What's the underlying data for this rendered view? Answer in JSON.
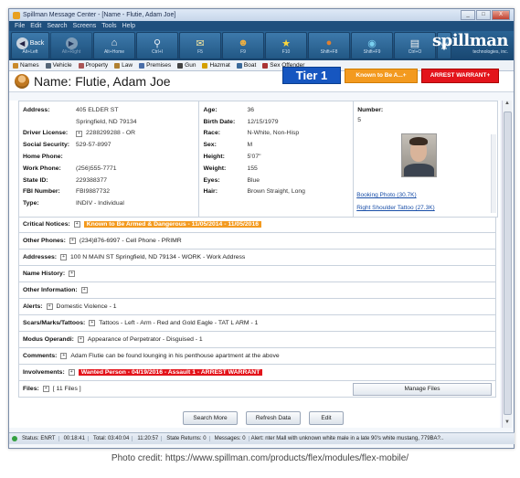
{
  "window": {
    "title": "Spillman Message Center - [Name - Flutie, Adam Joe]",
    "controls": [
      "_",
      "□",
      "X"
    ]
  },
  "menu": [
    "File",
    "Edit",
    "Search",
    "Screens",
    "Tools",
    "Help"
  ],
  "toolbar": {
    "back_label": "Back",
    "items": [
      {
        "caption": "Alt+Left",
        "icon": "back-icon"
      },
      {
        "caption": "Alt+Right",
        "icon": "forward-icon"
      },
      {
        "caption": "Alt+Home",
        "icon": "home-icon"
      },
      {
        "caption": "Ctrl+I",
        "icon": "search-icon"
      },
      {
        "caption": "F5",
        "icon": "mail-icon"
      },
      {
        "caption": "F9",
        "icon": "officer-icon"
      },
      {
        "caption": "F10",
        "icon": "star-icon"
      },
      {
        "caption": "Shift+F8",
        "icon": "badge-icon"
      },
      {
        "caption": "Shift+F9",
        "icon": "globe-icon"
      },
      {
        "caption": "Ctrl+O",
        "icon": "notepad-icon"
      }
    ],
    "brand": "spillman",
    "brand_sub": "technologies, inc."
  },
  "modules": [
    {
      "label": "Names",
      "color": "#c98a2a"
    },
    {
      "label": "Vehicle",
      "color": "#556677"
    },
    {
      "label": "Property",
      "color": "#a55"
    },
    {
      "label": "Law",
      "color": "#b08030"
    },
    {
      "label": "Premises",
      "color": "#4a6ea8"
    },
    {
      "label": "Gun",
      "color": "#444"
    },
    {
      "label": "Hazmat",
      "color": "#d4a000"
    },
    {
      "label": "Boat",
      "color": "#3a6a9a"
    },
    {
      "label": "Sex Offender",
      "color": "#a33"
    }
  ],
  "record": {
    "name_label": "Name:",
    "name": "Flutie, Adam Joe",
    "tier": "Tier 1",
    "alert_badge": "Known to Be A...+",
    "warrant_badge": "ARREST WARRANT+"
  },
  "details": {
    "left": [
      {
        "k": "Address:",
        "v": "405 ELDER ST"
      },
      {
        "k": "",
        "v": "Springfield, ND 79134"
      },
      {
        "k": "Driver License:",
        "v": "2288299288 - OR",
        "exp": true
      },
      {
        "k": "Social Security:",
        "v": "529-57-8997"
      },
      {
        "k": "Home Phone:",
        "v": ""
      },
      {
        "k": "Work Phone:",
        "v": "(256)555-7771"
      },
      {
        "k": "State ID:",
        "v": "229388377"
      },
      {
        "k": "FBI Number:",
        "v": "FBI9887732"
      },
      {
        "k": "Type:",
        "v": "INDIV - Individual"
      }
    ],
    "middle": [
      {
        "k": "Age:",
        "v": "36"
      },
      {
        "k": "Birth Date:",
        "v": "12/15/1979"
      },
      {
        "k": "Race:",
        "v": "N-White, Non-Hisp"
      },
      {
        "k": "Sex:",
        "v": "M"
      },
      {
        "k": "Height:",
        "v": "5'07\""
      },
      {
        "k": "Weight:",
        "v": "155"
      },
      {
        "k": "Eyes:",
        "v": "Blue"
      },
      {
        "k": "Hair:",
        "v": "Brown Straight, Long"
      }
    ],
    "right": {
      "number_label": "Number:",
      "number": "5",
      "booking_photo": "Booking Photo (30.7K)",
      "tattoo": "Right Shoulder Tattoo (27.3K)"
    }
  },
  "sections": [
    {
      "label": "Critical Notices:",
      "value": "Known to Be Armed & Dangerous - 11/05/2014 - 11/05/2016",
      "style": "orange"
    },
    {
      "label": "Other Phones:",
      "value": "(234)876-6997 - Cell Phone - PRIMR",
      "style": ""
    },
    {
      "label": "Addresses:",
      "value": "100 N MAIN ST  Springfield, ND  79134 - WORK - Work Address",
      "style": ""
    },
    {
      "label": "Name History:",
      "value": "",
      "style": ""
    },
    {
      "label": "Other Information:",
      "value": "",
      "style": ""
    },
    {
      "label": "Alerts:",
      "value": "Domestic Violence - 1",
      "style": ""
    },
    {
      "label": "Scars/Marks/Tattoos:",
      "value": "Tattoos - Left - Arm - Red and Gold Eagle - TAT L ARM - 1",
      "style": ""
    },
    {
      "label": "Modus Operandi:",
      "value": "Appearance of Perpetrator - Disguised - 1",
      "style": ""
    },
    {
      "label": "Comments:",
      "value": "Adam Flutie can be found lounging in his penthouse apartment at the above",
      "style": ""
    },
    {
      "label": "Involvements:",
      "value": "Wanted Person - 04/19/2016 - Assault 1 - ARREST WARRANT",
      "style": "red"
    },
    {
      "label": "Files:",
      "value": "[ 11 Files ]",
      "style": ""
    }
  ],
  "manage_files": "Manage Files",
  "buttons": {
    "search_more": "Search More",
    "refresh": "Refresh Data",
    "edit": "Edit"
  },
  "status": {
    "s1": "Status: ENRT",
    "s2": "00:18:41",
    "s3": "Total: 03:40:04",
    "s4": "11:20:57",
    "s5": "State Returns: 0",
    "s6": "Messages: 0",
    "s7": "Alert: nter Mall with unknown white male in a late 90's white mustang, 779BA?.."
  },
  "caption": "Photo credit: https://www.spillman.com/products/flex/modules/flex-mobile/"
}
